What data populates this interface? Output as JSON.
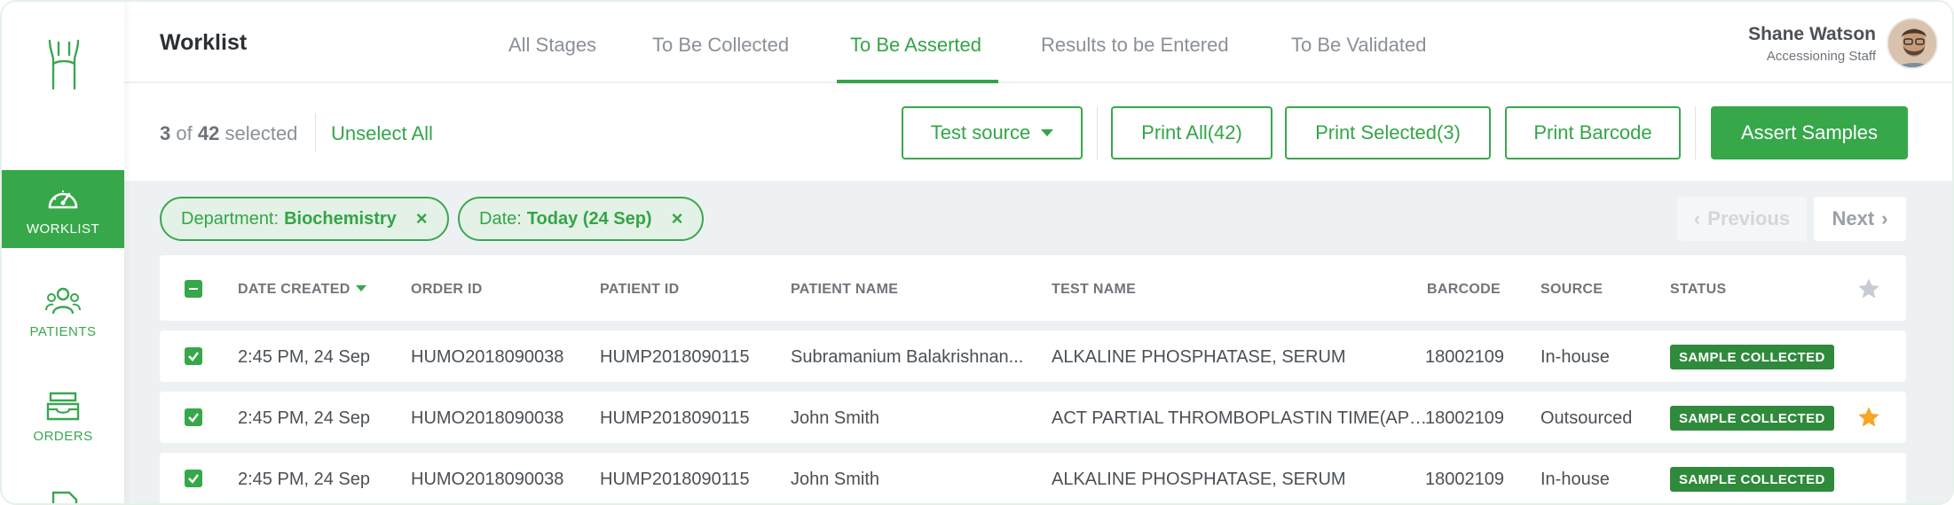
{
  "sidebar": {
    "items": [
      {
        "label": "WORKLIST",
        "icon": "speedometer-icon",
        "active": true
      },
      {
        "label": "PATIENTS",
        "icon": "users-icon",
        "active": false
      },
      {
        "label": "ORDERS",
        "icon": "inbox-icon",
        "active": false
      }
    ]
  },
  "header": {
    "title": "Worklist",
    "tabs": [
      {
        "label": "All Stages"
      },
      {
        "label": "To Be Collected"
      },
      {
        "label": "To Be Asserted"
      },
      {
        "label": "Results to be Entered"
      },
      {
        "label": "To Be Validated"
      }
    ],
    "active_tab": "To Be Asserted",
    "user": {
      "name": "Shane Watson",
      "role": "Accessioning Staff"
    }
  },
  "toolbar": {
    "selected_count": "3",
    "of_text": "of",
    "total_count": "42",
    "selected_text": "selected",
    "unselect_all": "Unselect All",
    "test_source": "Test source",
    "print_all": "Print All(42)",
    "print_selected": "Print Selected(3)",
    "print_barcode": "Print Barcode",
    "assert_samples": "Assert Samples"
  },
  "filters": [
    {
      "key": "Department:",
      "value": "Biochemistry"
    },
    {
      "key": "Date:",
      "value": "Today (24 Sep)"
    }
  ],
  "pagination": {
    "previous": "Previous",
    "next": "Next"
  },
  "table": {
    "columns": [
      "DATE CREATED",
      "ORDER ID",
      "PATIENT ID",
      "PATIENT NAME",
      "TEST NAME",
      "BARCODE",
      "SOURCE",
      "STATUS"
    ],
    "rows": [
      {
        "date": "2:45 PM,  24 Sep",
        "order_id": "HUMO2018090038",
        "patient_id": "HUMP2018090115",
        "patient_name": "Subramanium Balakrishnan...",
        "test_name": "ALKALINE PHOSPHATASE, SERUM",
        "barcode": "18002109",
        "source": "In-house",
        "status": "SAMPLE COLLECTED",
        "starred": false
      },
      {
        "date": "2:45 PM,  24 Sep",
        "order_id": "HUMO2018090038",
        "patient_id": "HUMP2018090115",
        "patient_name": "John Smith",
        "test_name": "ACT PARTIAL THROMBOPLASTIN TIME(AP…",
        "barcode": "18002109",
        "source": "Outsourced",
        "status": "SAMPLE COLLECTED",
        "starred": true
      },
      {
        "date": "2:45 PM,  24 Sep",
        "order_id": "HUMO2018090038",
        "patient_id": "HUMP2018090115",
        "patient_name": "John Smith",
        "test_name": "ALKALINE PHOSPHATASE, SERUM",
        "barcode": "18002109",
        "source": "In-house",
        "status": "SAMPLE COLLECTED",
        "starred": false
      }
    ]
  },
  "colors": {
    "accent": "#36a84a",
    "badge": "#2f8a3c",
    "star": "#f5a623",
    "muted": "#8a9097"
  }
}
